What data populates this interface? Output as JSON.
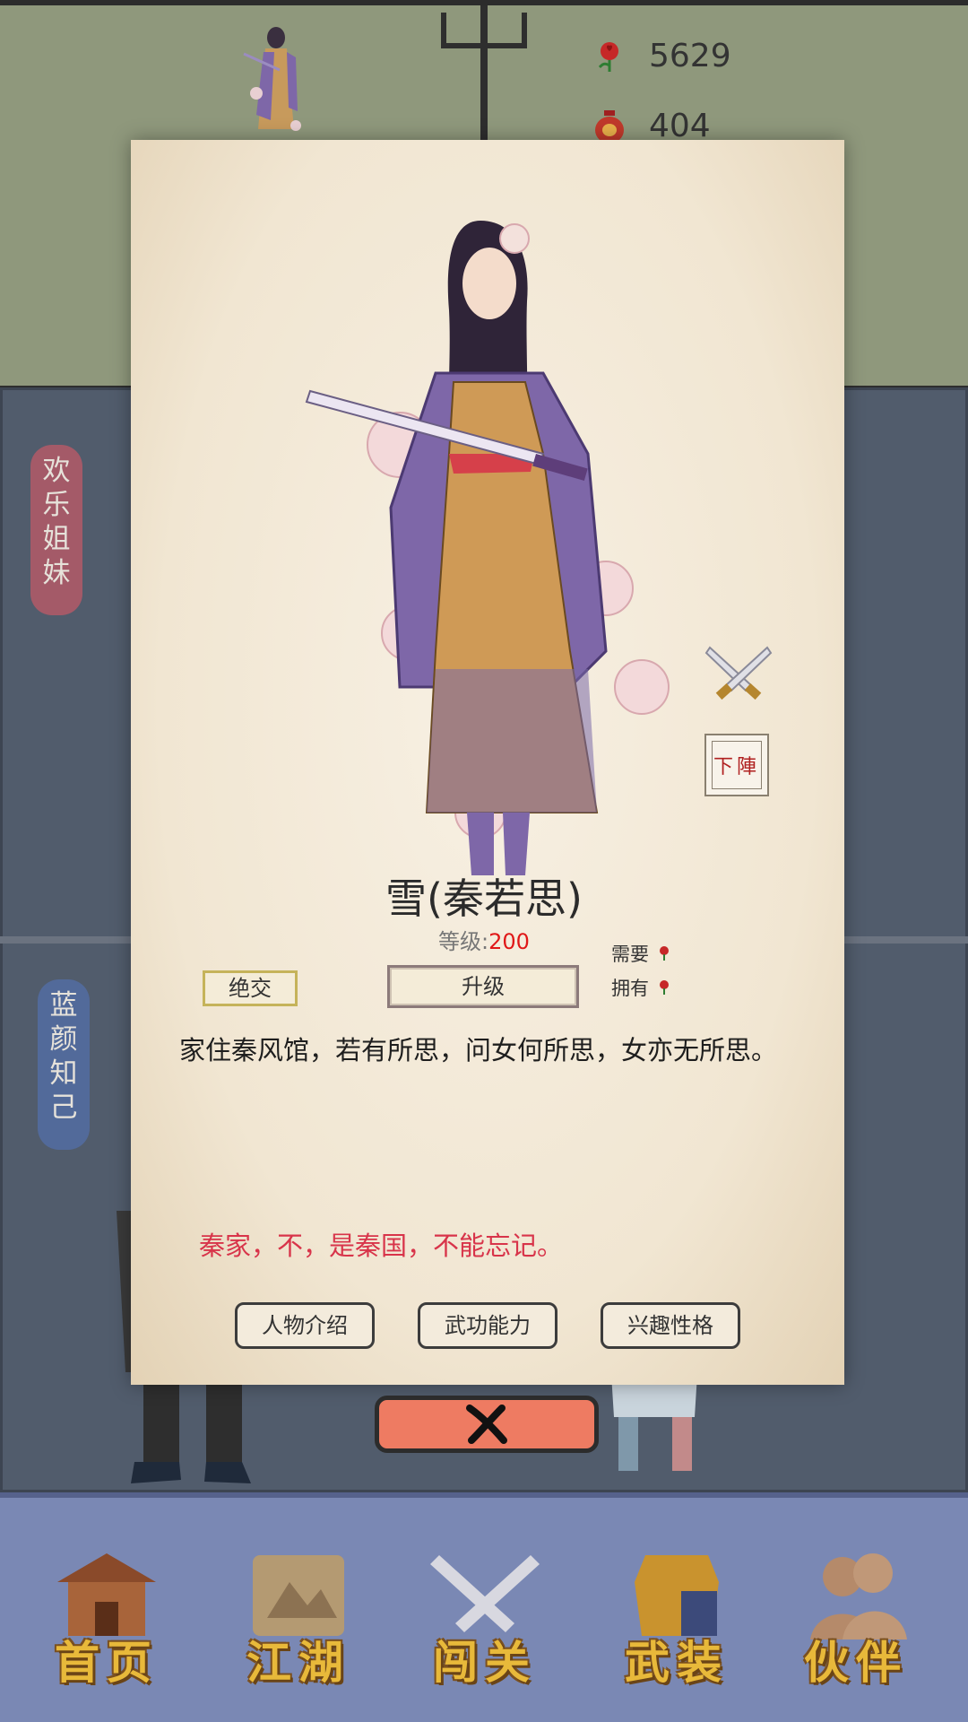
{
  "currencies": [
    {
      "icon": "rose-icon",
      "value": "5629"
    },
    {
      "icon": "wine-jar-icon",
      "value": "404"
    }
  ],
  "side_tags": [
    {
      "label": "欢乐姐妹",
      "chars": [
        "欢",
        "乐",
        "姐",
        "妹"
      ],
      "color": "#a45a68"
    },
    {
      "label": "蓝颜知己",
      "chars": [
        "蓝",
        "颜",
        "知",
        "己"
      ],
      "color": "#526a9a"
    }
  ],
  "character": {
    "name": "雪(秦若思)",
    "level_label": "等级:",
    "level_value": "200",
    "cost_need_label": "需要",
    "cost_have_label": "拥有",
    "break_label": "绝交",
    "upgrade_label": "升级",
    "description": "家住秦风馆，若有所思，问女何所思，女亦无所思。",
    "quote": "秦家，不，是秦国，不能忘记。",
    "retreat_label": "下陣",
    "retreat_chars": [
      "下",
      "陣"
    ]
  },
  "tabs": [
    {
      "label": "人物介绍"
    },
    {
      "label": "武功能力"
    },
    {
      "label": "兴趣性格"
    }
  ],
  "nav": [
    {
      "label": "首页",
      "icon": "house-icon"
    },
    {
      "label": "江湖",
      "icon": "scroll-icon"
    },
    {
      "label": "闯关",
      "icon": "crossed-swords-icon"
    },
    {
      "label": "武装",
      "icon": "armor-icon"
    },
    {
      "label": "伙伴",
      "icon": "companions-icon"
    }
  ],
  "colors": {
    "accent_red": "#e01818",
    "quote_red": "#d8344a",
    "close_button": "#ee7b62",
    "nav_bg": "#7a88b4",
    "nav_text": "#e8b93a"
  }
}
